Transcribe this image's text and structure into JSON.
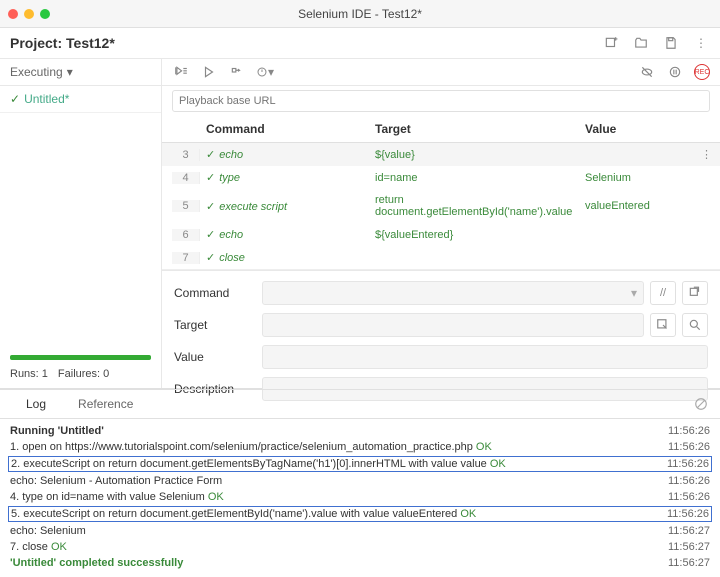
{
  "window": {
    "title": "Selenium IDE - Test12*"
  },
  "project": {
    "label": "Project:",
    "name": "Test12*"
  },
  "sidebar": {
    "status_label": "Executing",
    "tests": [
      {
        "name": "Untitled*",
        "passed": true
      }
    ],
    "runs_label": "Runs: 1",
    "failures_label": "Failures: 0"
  },
  "toolbar": {
    "url_placeholder": "Playback base URL"
  },
  "grid": {
    "headers": {
      "command": "Command",
      "target": "Target",
      "value": "Value"
    },
    "rows": [
      {
        "n": "3",
        "cmd": "echo",
        "tgt": "${value}",
        "val": "",
        "sel": true
      },
      {
        "n": "4",
        "cmd": "type",
        "tgt": "id=name",
        "val": "Selenium"
      },
      {
        "n": "5",
        "cmd": "execute script",
        "tgt": "return document.getElementById('name').value",
        "val": "valueEntered"
      },
      {
        "n": "6",
        "cmd": "echo",
        "tgt": "${valueEntered}",
        "val": ""
      },
      {
        "n": "7",
        "cmd": "close",
        "tgt": "",
        "val": ""
      }
    ]
  },
  "form": {
    "command_label": "Command",
    "target_label": "Target",
    "value_label": "Value",
    "description_label": "Description"
  },
  "tabs": {
    "log": "Log",
    "reference": "Reference"
  },
  "log": {
    "entries": [
      {
        "text": "Running 'Untitled'",
        "time": "11:56:26",
        "cls": "log-running"
      },
      {
        "pre": "1.  open on https://www.tutorialspoint.com/selenium/practice/selenium_automation_practice.php ",
        "ok": "OK",
        "time": "11:56:26"
      },
      {
        "pre": "2.  executeScript on return document.getElementsByTagName('h1')[0].innerHTML with value value ",
        "ok": "OK",
        "time": "11:56:26",
        "hl": true
      },
      {
        "text": "echo: Selenium - Automation Practice Form",
        "time": "11:56:26"
      },
      {
        "pre": "4.  type on id=name with value Selenium ",
        "ok": "OK",
        "time": "11:56:26"
      },
      {
        "pre": "5.  executeScript on return document.getElementById('name').value with value valueEntered ",
        "ok": "OK",
        "time": "11:56:26",
        "hl": true
      },
      {
        "text": "echo: Selenium",
        "time": "11:56:27"
      },
      {
        "pre": "7.  close ",
        "ok": "OK",
        "time": "11:56:27"
      },
      {
        "text": "'Untitled' completed successfully",
        "time": "11:56:27",
        "cls": "log-success"
      }
    ]
  }
}
